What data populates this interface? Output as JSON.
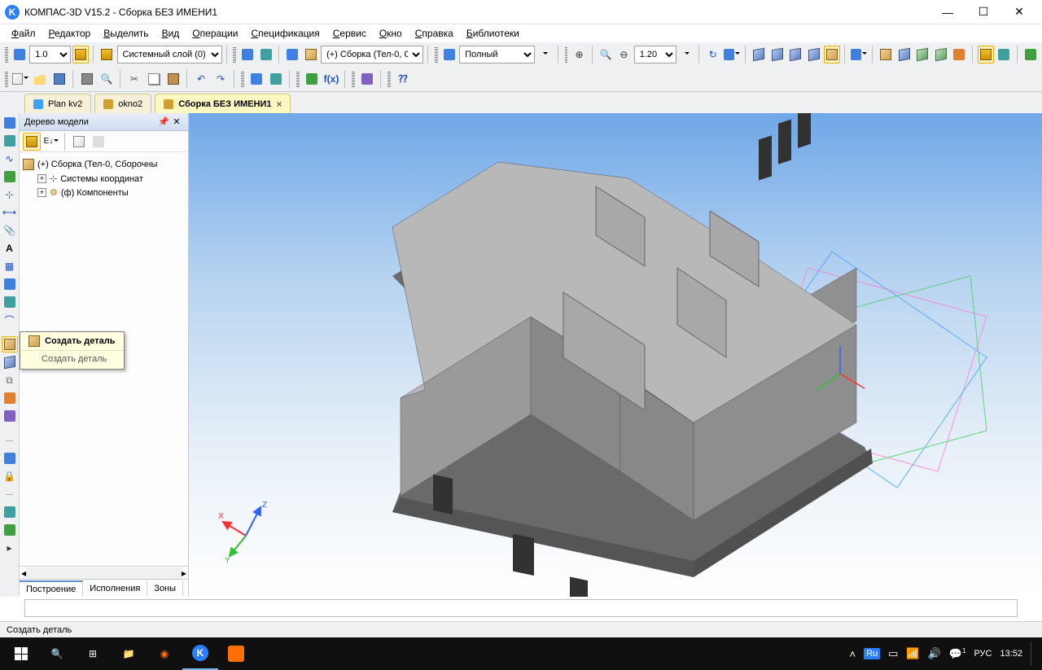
{
  "app": {
    "title": "КОМПАС-3D V15.2  - Сборка БЕЗ ИМЕНИ1"
  },
  "menu": {
    "items": [
      "Файл",
      "Редактор",
      "Выделить",
      "Вид",
      "Операции",
      "Спецификация",
      "Сервис",
      "Окно",
      "Справка",
      "Библиотеки"
    ]
  },
  "toolbar1": {
    "scale_value": "1.0",
    "layer_label": "Системный слой (0)",
    "assembly_label": "(+) Сборка (Тел-0, С",
    "display_mode": "Полный",
    "zoom_value": "1.20"
  },
  "tabs": {
    "items": [
      {
        "label": "Plan kv2"
      },
      {
        "label": "okno2"
      },
      {
        "label": "Сборка БЕЗ ИМЕНИ1",
        "active": true,
        "closable": true
      }
    ]
  },
  "panel": {
    "title": "Дерево модели",
    "root": "(+) Сборка (Тел-0, Сборочны",
    "child1": "Системы координат",
    "child2": "(ф) Компоненты",
    "bottom_tabs": [
      "Построение",
      "Исполнения",
      "Зоны"
    ]
  },
  "tooltip": {
    "title": "Создать деталь",
    "hint": "Создать деталь"
  },
  "axes": {
    "x": "X",
    "y": "Y",
    "z": "Z"
  },
  "statusbar": {
    "text": "Создать деталь"
  },
  "taskbar": {
    "tray_lang_short": "Ru",
    "tray_lang": "РУС",
    "tray_time": "13:52",
    "notif": "1"
  }
}
